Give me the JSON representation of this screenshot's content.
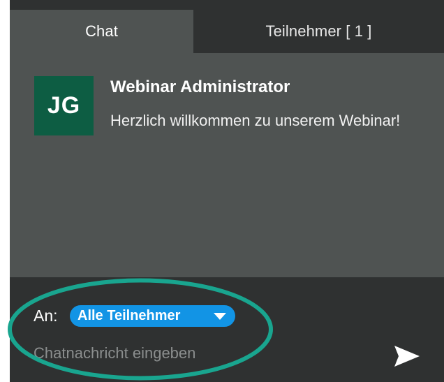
{
  "tabs": {
    "chat_label": "Chat",
    "participants_label": "Teilnehmer [ 1 ]"
  },
  "message": {
    "avatar_initials": "JG",
    "sender": "Webinar Administrator",
    "text": "Herzlich willkommen zu unserem Webinar!"
  },
  "composer": {
    "recipient_label": "An:",
    "recipient_value": "Alle Teilnehmer",
    "placeholder": "Chatnachricht eingeben",
    "send_icon": "send-icon",
    "dropdown_icon": "chevron-down-icon"
  },
  "colors": {
    "panel_background": "#4f5352",
    "tab_bar_background": "#2f3131",
    "avatar_background": "#0d5d43",
    "recipient_chip": "#1294e5",
    "highlight": "#19a58f"
  }
}
